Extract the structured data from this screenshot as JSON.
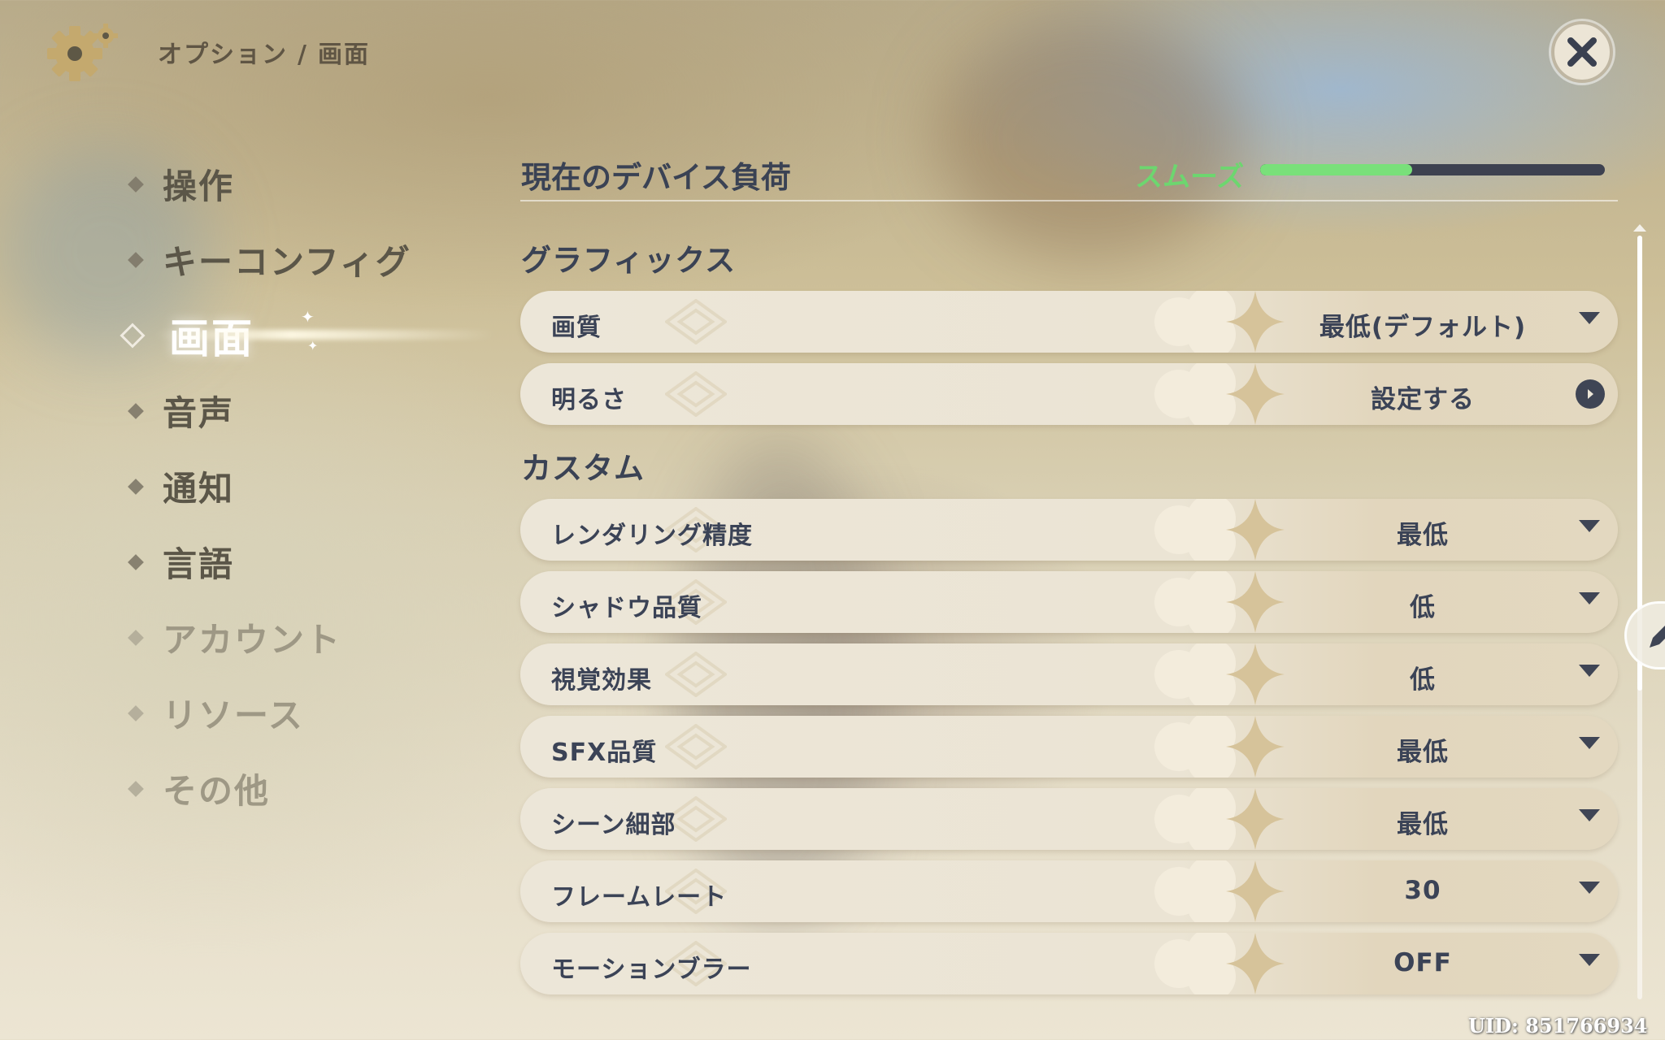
{
  "header": {
    "breadcrumb_parent": "オプション",
    "breadcrumb_sep": "/",
    "breadcrumb_current": "画面",
    "settings_icon": "gear-icon",
    "close_icon": "close-icon"
  },
  "sidebar": {
    "items": [
      {
        "label": "操作",
        "state": "normal"
      },
      {
        "label": "キーコンフィグ",
        "state": "normal"
      },
      {
        "label": "画面",
        "state": "active"
      },
      {
        "label": "音声",
        "state": "normal"
      },
      {
        "label": "通知",
        "state": "normal"
      },
      {
        "label": "言語",
        "state": "normal"
      },
      {
        "label": "アカウント",
        "state": "faded"
      },
      {
        "label": "リソース",
        "state": "faded"
      },
      {
        "label": "その他",
        "state": "faded"
      }
    ]
  },
  "device_load": {
    "title": "現在のデバイス負荷",
    "status": "スムーズ",
    "level_fraction": 0.44,
    "status_color": "#6dd66f"
  },
  "graphics": {
    "section_title": "グラフィックス",
    "rows": [
      {
        "name": "画質",
        "value": "最低(デフォルト)",
        "control": "dropdown"
      },
      {
        "name": "明るさ",
        "value": "設定する",
        "control": "arrow"
      }
    ]
  },
  "custom": {
    "section_title": "カスタム",
    "rows": [
      {
        "name": "レンダリング精度",
        "value": "最低",
        "control": "dropdown"
      },
      {
        "name": "シャドウ品質",
        "value": "低",
        "control": "dropdown"
      },
      {
        "name": "視覚効果",
        "value": "低",
        "control": "dropdown"
      },
      {
        "name": "SFX品質",
        "value": "最低",
        "control": "dropdown"
      },
      {
        "name": "シーン細部",
        "value": "最低",
        "control": "dropdown"
      },
      {
        "name": "フレームレート",
        "value": "30",
        "control": "dropdown"
      },
      {
        "name": "モーションブラー",
        "value": "OFF",
        "control": "dropdown"
      }
    ]
  },
  "footer": {
    "uid": "UID: 851766934"
  },
  "colors": {
    "accent_gold": "#c9b37c",
    "text_dark": "#3b4356",
    "active_label": "#ffffff"
  },
  "edit_icon": "pencil-icon"
}
